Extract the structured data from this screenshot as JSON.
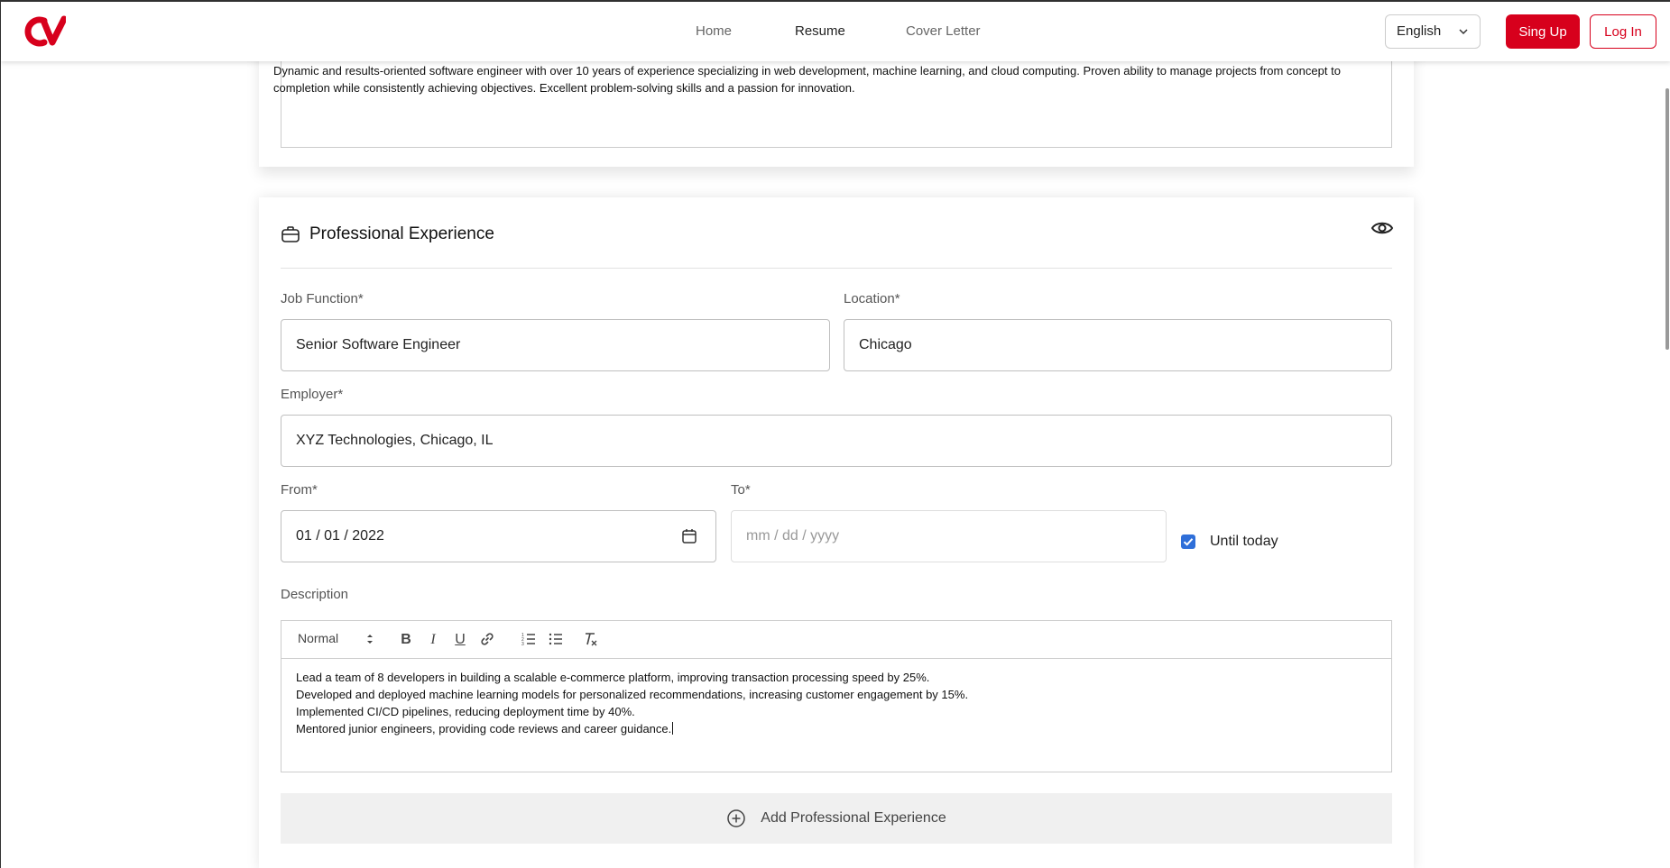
{
  "header": {
    "nav": [
      {
        "label": "Home",
        "active": false
      },
      {
        "label": "Resume",
        "active": true
      },
      {
        "label": "Cover Letter",
        "active": false
      }
    ],
    "language": "English",
    "signup_label": "Sing Up",
    "login_label": "Log In",
    "accent_color": "#d7001c"
  },
  "summary": {
    "text": "Dynamic and results-oriented software engineer with over 10 years of experience specializing in web development, machine learning, and cloud computing. Proven ability to manage projects from concept to completion while consistently achieving objectives. Excellent problem-solving skills and a passion for innovation."
  },
  "experience": {
    "title": "Professional Experience",
    "job_function": {
      "label": "Job Function*",
      "value": "Senior Software Engineer"
    },
    "location": {
      "label": "Location*",
      "value": "Chicago"
    },
    "employer": {
      "label": "Employer*",
      "value": "XYZ Technologies, Chicago, IL"
    },
    "from": {
      "label": "From*",
      "value": "01 / 01 / 2022"
    },
    "to": {
      "label": "To*",
      "placeholder": "mm / dd / yyyy"
    },
    "until_today": {
      "label": "Until today",
      "checked": true
    },
    "description": {
      "label": "Description",
      "format": "Normal",
      "lines": [
        "Lead a team of 8 developers in building a scalable e-commerce platform, improving transaction processing speed by 25%.",
        "Developed and deployed machine learning models for personalized recommendations, increasing customer engagement by 15%.",
        "Implemented CI/CD pipelines, reducing deployment time by 40%.",
        "Mentored junior engineers, providing code reviews and career guidance."
      ]
    },
    "add_label": "Add Professional Experience"
  }
}
